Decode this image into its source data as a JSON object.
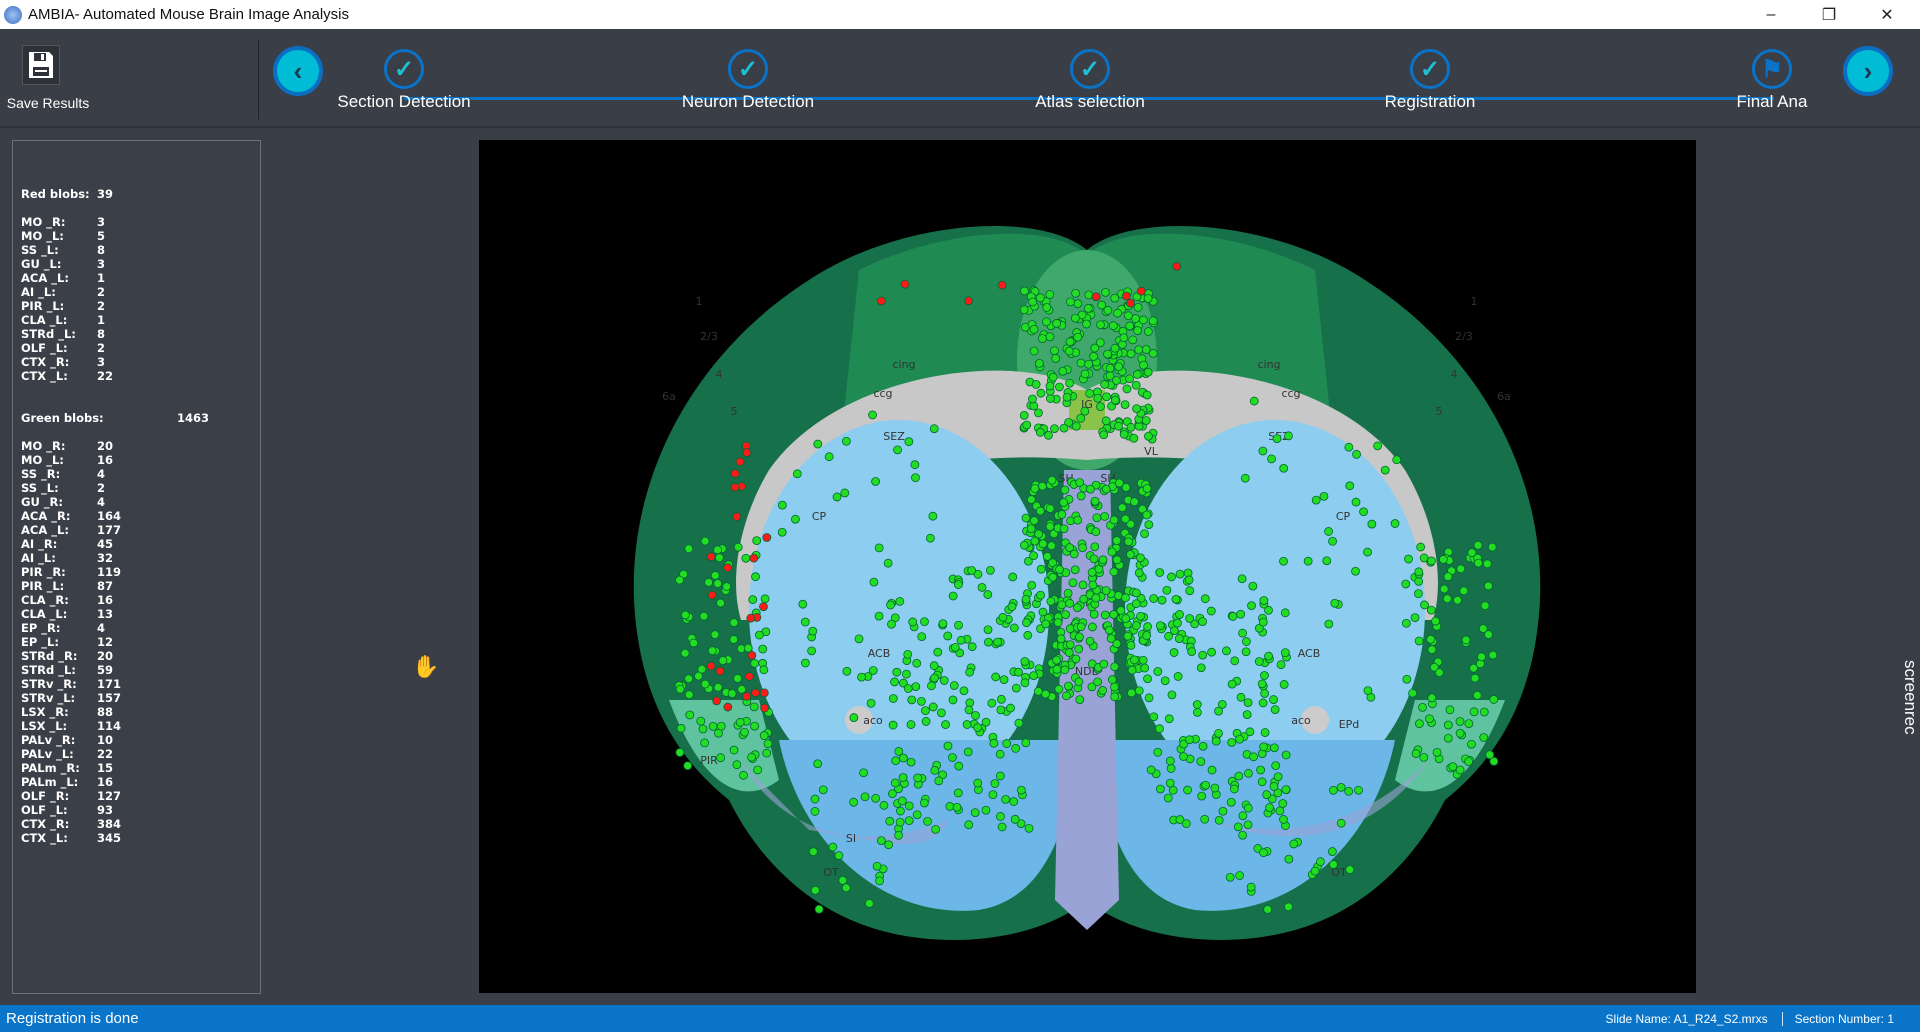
{
  "window": {
    "title": "AMBIA- Automated Mouse Brain Image Analysis",
    "minimize": "–",
    "restore": "❐",
    "close": "✕"
  },
  "toolbar": {
    "save_label": "Save Results",
    "back_icon": "chevron-left-icon",
    "next_icon": "chevron-right-icon",
    "steps": [
      {
        "label": "Section Detection",
        "state": "done"
      },
      {
        "label": "Neuron Detection",
        "state": "done"
      },
      {
        "label": "Atlas selection",
        "state": "done"
      },
      {
        "label": "Registration",
        "state": "done"
      },
      {
        "label": "Final Ana",
        "state": "current"
      }
    ]
  },
  "stats": {
    "red_label": "Red blobs:",
    "red_total": "39",
    "red": [
      [
        "MO _R:",
        "3"
      ],
      [
        "MO _L:",
        "5"
      ],
      [
        "SS _L:",
        "8"
      ],
      [
        "GU _L:",
        "3"
      ],
      [
        "ACA _L:",
        "1"
      ],
      [
        "AI _L:",
        "2"
      ],
      [
        "PIR _L:",
        "2"
      ],
      [
        "CLA _L:",
        "1"
      ],
      [
        "STRd _L:",
        "8"
      ],
      [
        "OLF _L:",
        "2"
      ],
      [
        "CTX _R:",
        "3"
      ],
      [
        "CTX _L:",
        "22"
      ]
    ],
    "green_label": "Green blobs:",
    "green_total": "1463",
    "green": [
      [
        "MO _R:",
        "20"
      ],
      [
        "MO _L:",
        "16"
      ],
      [
        "SS _R:",
        "4"
      ],
      [
        "SS _L:",
        "2"
      ],
      [
        "GU _R:",
        "4"
      ],
      [
        "ACA _R:",
        "164"
      ],
      [
        "ACA _L:",
        "177"
      ],
      [
        "AI _R:",
        "45"
      ],
      [
        "AI _L:",
        "32"
      ],
      [
        "PIR _R:",
        "119"
      ],
      [
        "PIR _L:",
        "87"
      ],
      [
        "CLA _R:",
        "16"
      ],
      [
        "CLA _L:",
        "13"
      ],
      [
        "EP _R:",
        "4"
      ],
      [
        "EP _L:",
        "12"
      ],
      [
        "STRd _R:",
        "20"
      ],
      [
        "STRd _L:",
        "59"
      ],
      [
        "STRv _R:",
        "171"
      ],
      [
        "STRv _L:",
        "157"
      ],
      [
        "LSX _R:",
        "88"
      ],
      [
        "LSX _L:",
        "114"
      ],
      [
        "PALv _R:",
        "10"
      ],
      [
        "PALv _L:",
        "22"
      ],
      [
        "PALm _R:",
        "15"
      ],
      [
        "PALm _L:",
        "16"
      ],
      [
        "OLF _R:",
        "127"
      ],
      [
        "OLF _L:",
        "93"
      ],
      [
        "CTX _R:",
        "384"
      ],
      [
        "CTX _L:",
        "345"
      ]
    ]
  },
  "atlas_labels": [
    "CP",
    "CP",
    "ACB",
    "ACB",
    "MS",
    "NDB",
    "SI",
    "OT",
    "OT",
    "IG",
    "SH",
    "SH",
    "VL",
    "PIR",
    "EPd",
    "aco",
    "aco",
    "ccg",
    "ccg",
    "cing",
    "cing",
    "SEZ",
    "SEZ",
    "6a",
    "6a",
    "1",
    "1",
    "2/3",
    "2/3",
    "4",
    "4",
    "5",
    "5"
  ],
  "colors": {
    "cortex": "#1f8a52",
    "cortex_dark": "#16704a",
    "striatum": "#8ccdf0",
    "white_matter": "#c8c8c8",
    "red_blob": "#ff1a1a",
    "green_blob": "#22dd22",
    "accent": "#0a74c9"
  },
  "watermark": "screenrec",
  "status": {
    "message": "Registration is done",
    "slide": "Slide Name: A1_R24_S2.mrxs",
    "section": "Section Number: 1"
  }
}
